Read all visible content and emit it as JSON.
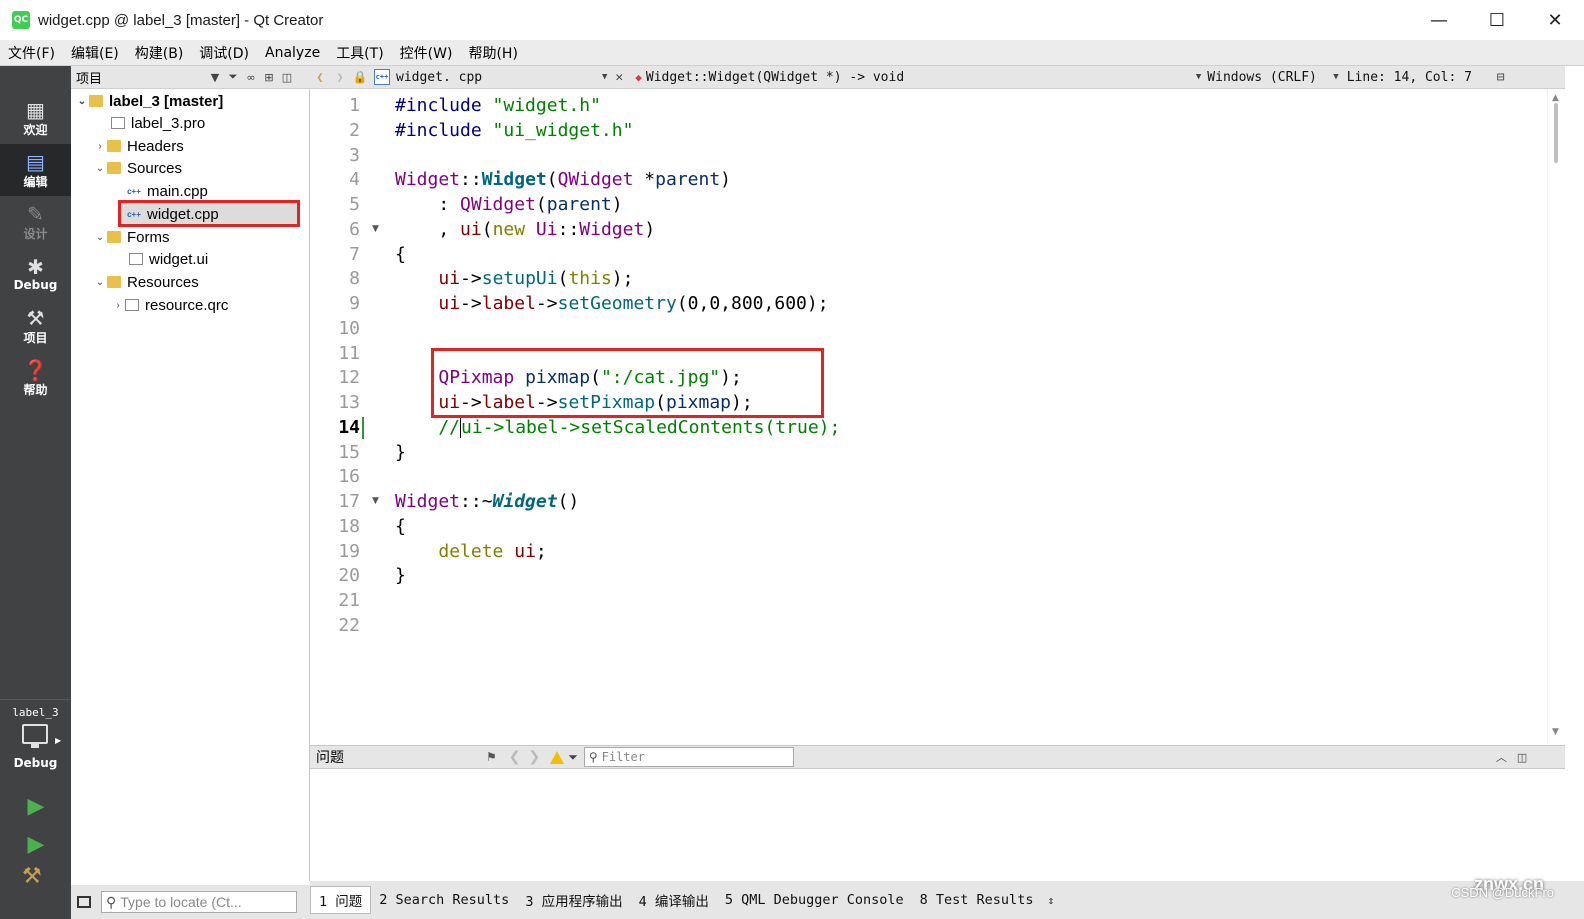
{
  "window": {
    "title": "widget.cpp @ label_3 [master] - Qt Creator",
    "logo_text": "QC",
    "minimize": "—",
    "maximize": "☐",
    "close": "✕"
  },
  "menu": [
    "文件(F)",
    "编辑(E)",
    "构建(B)",
    "调试(D)",
    "Analyze",
    "工具(T)",
    "控件(W)",
    "帮助(H)"
  ],
  "modes": [
    {
      "label": "欢迎",
      "icon": "grid-icon"
    },
    {
      "label": "编辑",
      "icon": "document-icon"
    },
    {
      "label": "设计",
      "icon": "pencil-icon"
    },
    {
      "label": "Debug",
      "icon": "bug-icon"
    },
    {
      "label": "项目",
      "icon": "wrench-icon"
    },
    {
      "label": "帮助",
      "icon": "help-icon"
    }
  ],
  "kit": {
    "name": "label_3",
    "mode": "Debug"
  },
  "project_pane": {
    "title": "项目",
    "tree": [
      {
        "label": "label_3 [master]",
        "type": "folder"
      },
      {
        "label": "label_3.pro",
        "type": "file"
      },
      {
        "label": "Headers",
        "type": "folder"
      },
      {
        "label": "Sources",
        "type": "folder"
      },
      {
        "label": "main.cpp",
        "type": "cpp"
      },
      {
        "label": "widget.cpp",
        "type": "cpp"
      },
      {
        "label": "Forms",
        "type": "folder"
      },
      {
        "label": "widget.ui",
        "type": "file"
      },
      {
        "label": "Resources",
        "type": "folder"
      },
      {
        "label": "resource.qrc",
        "type": "file"
      }
    ],
    "locator_placeholder": "Type to locate (Ct..."
  },
  "editor": {
    "filename": "widget. cpp",
    "symbol": "Widget::Widget(QWidget *) -> void",
    "line_ending": "Windows (CRLF)",
    "position": "Line: 14, Col: 7",
    "current_line": 14,
    "line_numbers": [
      "1",
      "2",
      "3",
      "4",
      "5",
      "6",
      "7",
      "8",
      "9",
      "10",
      "11",
      "12",
      "13",
      "14",
      "15",
      "16",
      "17",
      "18",
      "19",
      "20",
      "21",
      "22"
    ],
    "code": {
      "l1a": "#include ",
      "l1b": "\"widget.h\"",
      "l2a": "#include ",
      "l2b": "\"ui_widget.h\"",
      "l4a": "Widget",
      "l4b": "::",
      "l4c": "Widget",
      "l4d": "(",
      "l4e": "QWidget",
      "l4f": " *",
      "l4g": "parent",
      "l4h": ")",
      "l5a": "    : ",
      "l5b": "QWidget",
      "l5c": "(",
      "l5d": "parent",
      "l5e": ")",
      "l6a": "    , ",
      "l6b": "ui",
      "l6c": "(",
      "l6d": "new",
      "l6e": " ",
      "l6f": "Ui",
      "l6g": "::",
      "l6h": "Widget",
      "l6i": ")",
      "l7": "{",
      "l8a": "    ",
      "l8b": "ui",
      "l8c": "->",
      "l8d": "setupUi",
      "l8e": "(",
      "l8f": "this",
      "l8g": ");",
      "l9a": "    ",
      "l9b": "ui",
      "l9c": "->",
      "l9d": "label",
      "l9e": "->",
      "l9f": "setGeometry",
      "l9g": "(0,0,800,600);",
      "l12a": "    ",
      "l12b": "QPixmap",
      "l12c": " ",
      "l12d": "pixmap",
      "l12e": "(",
      "l12f": "\":/cat.jpg\"",
      "l12g": ");",
      "l13a": "    ",
      "l13b": "ui",
      "l13c": "->",
      "l13d": "label",
      "l13e": "->",
      "l13f": "setPixmap",
      "l13g": "(",
      "l13h": "pixmap",
      "l13i": ");",
      "l14a": "    //",
      "l14b": "ui->label->setScaledContents(true);",
      "l15": "}",
      "l17a": "Widget",
      "l17b": "::~",
      "l17c": "Widget",
      "l17d": "()",
      "l18": "{",
      "l19a": "    ",
      "l19b": "delete",
      "l19c": " ",
      "l19d": "ui",
      "l19e": ";",
      "l20": "}"
    }
  },
  "issues_pane": {
    "title": "问题",
    "filter_placeholder": "Filter"
  },
  "status_tabs": [
    "1 问题",
    "2 Search Results",
    "3 应用程序输出",
    "4 编译输出",
    "5 QML Debugger Console",
    "8 Test Results"
  ],
  "watermark": "CSDN @DuckFro",
  "watermark2": "znwx.cn",
  "colors": {
    "modebar": "#404244",
    "highlight_box": "#e02424",
    "preprocessor": "#000080",
    "string": "#008000",
    "type": "#800080",
    "keyword": "#808000",
    "function": "#00677c"
  }
}
